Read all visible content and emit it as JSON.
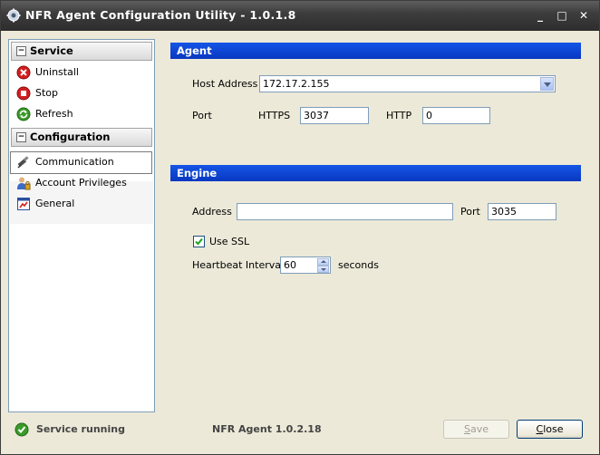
{
  "window": {
    "title": "NFR Agent Configuration Utility - 1.0.1.8",
    "minimize": "_",
    "maximize": "□",
    "close": "✕"
  },
  "sidebar": {
    "service_header": "Service",
    "service_items": [
      {
        "label": "Uninstall",
        "icon": "uninstall-icon"
      },
      {
        "label": "Stop",
        "icon": "stop-icon"
      },
      {
        "label": "Refresh",
        "icon": "refresh-icon"
      }
    ],
    "configuration_header": "Configuration",
    "configuration_items": [
      {
        "label": "Communication",
        "icon": "communication-icon",
        "selected": true
      },
      {
        "label": "Account Privileges",
        "icon": "account-privileges-icon"
      },
      {
        "label": "General",
        "icon": "general-icon"
      }
    ]
  },
  "agent": {
    "section_title": "Agent",
    "host_label": "Host Address",
    "host_value": "172.17.2.155",
    "port_label": "Port",
    "https_label": "HTTPS",
    "https_value": "3037",
    "http_label": "HTTP",
    "http_value": "0"
  },
  "engine": {
    "section_title": "Engine",
    "address_label": "Address",
    "address_value": "",
    "port_label": "Port",
    "port_value": "3035",
    "use_ssl_label": "Use SSL",
    "use_ssl_checked": true,
    "heartbeat_label": "Heartbeat Interval",
    "heartbeat_value": "60",
    "heartbeat_unit": "seconds"
  },
  "status": {
    "text": "Service running",
    "version": "NFR Agent 1.0.2.18",
    "save_label_underline": "S",
    "save_label_rest": "ave",
    "close_label_underline": "C",
    "close_label_rest": "lose"
  },
  "colors": {
    "section_bar": "#0a3ec4",
    "titlebar": "#3d3d3d",
    "status_ok": "#3a9a2a"
  }
}
